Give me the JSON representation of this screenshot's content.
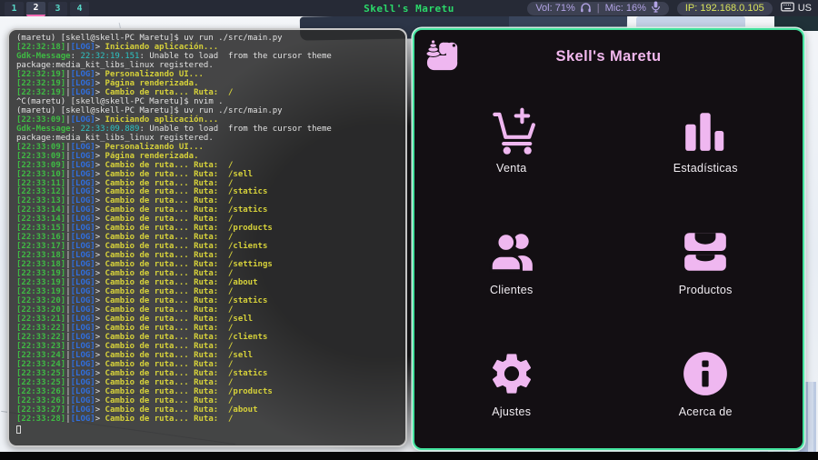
{
  "topbar": {
    "workspaces": [
      "1",
      "2",
      "3",
      "4"
    ],
    "active_workspace": "2",
    "title": "Skell's Maretu",
    "volume_label": "Vol: 71%",
    "mic_label": "Mic: 16%",
    "module_separator": "|",
    "ip_label": "IP: 192.168.0.105",
    "layout_label": "US",
    "colors": {
      "bg": "#262a36",
      "title": "#2bd96a",
      "underline": "#f56cb5",
      "module_text": "#b3a4e6",
      "ip_text": "#d9e35b",
      "ws_text": "#58d8c8"
    }
  },
  "terminal": {
    "log_tag": "LOG",
    "gdk_label": "Gdk-Message",
    "colors": {
      "white": "#e2e2e2",
      "green": "#3fba44",
      "blue": "#2f6fe0",
      "yellow": "#d6d13a",
      "cyan": "#2cc3c3"
    },
    "lines": [
      {
        "t": "cmd",
        "text": "(maretu) [skell@skell-PC Maretu]$ uv run ./src/main.py"
      },
      {
        "t": "log",
        "time": "22:32:18",
        "msg": "Iniciando aplicación..."
      },
      {
        "t": "gdk",
        "time": "22:32:19.151",
        "msg": "Unable to load  from the cursor theme"
      },
      {
        "t": "cmd",
        "text": "package:media_kit_libs_linux registered."
      },
      {
        "t": "log",
        "time": "22:32:19",
        "msg": "Personalizando UI..."
      },
      {
        "t": "log",
        "time": "22:32:19",
        "msg": "Página renderizada."
      },
      {
        "t": "log",
        "time": "22:32:19",
        "msg": "Cambio de ruta... Ruta:  /"
      },
      {
        "t": "cmd",
        "text": "^C(maretu) [skell@skell-PC Maretu]$ nvim ."
      },
      {
        "t": "cmd",
        "text": "(maretu) [skell@skell-PC Maretu]$ uv run ./src/main.py"
      },
      {
        "t": "log",
        "time": "22:33:09",
        "msg": "Iniciando aplicación..."
      },
      {
        "t": "gdk",
        "time": "22:33:09.889",
        "msg": "Unable to load  from the cursor theme"
      },
      {
        "t": "cmd",
        "text": "package:media_kit_libs_linux registered."
      },
      {
        "t": "log",
        "time": "22:33:09",
        "msg": "Personalizando UI..."
      },
      {
        "t": "log",
        "time": "22:33:09",
        "msg": "Página renderizada."
      },
      {
        "t": "log",
        "time": "22:33:09",
        "msg": "Cambio de ruta... Ruta:  /"
      },
      {
        "t": "log",
        "time": "22:33:10",
        "msg": "Cambio de ruta... Ruta:  /sell"
      },
      {
        "t": "log",
        "time": "22:33:11",
        "msg": "Cambio de ruta... Ruta:  /"
      },
      {
        "t": "log",
        "time": "22:33:12",
        "msg": "Cambio de ruta... Ruta:  /statics"
      },
      {
        "t": "log",
        "time": "22:33:13",
        "msg": "Cambio de ruta... Ruta:  /"
      },
      {
        "t": "log",
        "time": "22:33:14",
        "msg": "Cambio de ruta... Ruta:  /statics"
      },
      {
        "t": "log",
        "time": "22:33:14",
        "msg": "Cambio de ruta... Ruta:  /"
      },
      {
        "t": "log",
        "time": "22:33:15",
        "msg": "Cambio de ruta... Ruta:  /products"
      },
      {
        "t": "log",
        "time": "22:33:16",
        "msg": "Cambio de ruta... Ruta:  /"
      },
      {
        "t": "log",
        "time": "22:33:17",
        "msg": "Cambio de ruta... Ruta:  /clients"
      },
      {
        "t": "log",
        "time": "22:33:18",
        "msg": "Cambio de ruta... Ruta:  /"
      },
      {
        "t": "log",
        "time": "22:33:18",
        "msg": "Cambio de ruta... Ruta:  /settings"
      },
      {
        "t": "log",
        "time": "22:33:19",
        "msg": "Cambio de ruta... Ruta:  /"
      },
      {
        "t": "log",
        "time": "22:33:19",
        "msg": "Cambio de ruta... Ruta:  /about"
      },
      {
        "t": "log",
        "time": "22:33:19",
        "msg": "Cambio de ruta... Ruta:  /"
      },
      {
        "t": "log",
        "time": "22:33:20",
        "msg": "Cambio de ruta... Ruta:  /statics"
      },
      {
        "t": "log",
        "time": "22:33:20",
        "msg": "Cambio de ruta... Ruta:  /"
      },
      {
        "t": "log",
        "time": "22:33:21",
        "msg": "Cambio de ruta... Ruta:  /sell"
      },
      {
        "t": "log",
        "time": "22:33:22",
        "msg": "Cambio de ruta... Ruta:  /"
      },
      {
        "t": "log",
        "time": "22:33:22",
        "msg": "Cambio de ruta... Ruta:  /clients"
      },
      {
        "t": "log",
        "time": "22:33:23",
        "msg": "Cambio de ruta... Ruta:  /"
      },
      {
        "t": "log",
        "time": "22:33:24",
        "msg": "Cambio de ruta... Ruta:  /sell"
      },
      {
        "t": "log",
        "time": "22:33:24",
        "msg": "Cambio de ruta... Ruta:  /"
      },
      {
        "t": "log",
        "time": "22:33:25",
        "msg": "Cambio de ruta... Ruta:  /statics"
      },
      {
        "t": "log",
        "time": "22:33:25",
        "msg": "Cambio de ruta... Ruta:  /"
      },
      {
        "t": "log",
        "time": "22:33:26",
        "msg": "Cambio de ruta... Ruta:  /products"
      },
      {
        "t": "log",
        "time": "22:33:26",
        "msg": "Cambio de ruta... Ruta:  /"
      },
      {
        "t": "log",
        "time": "22:33:27",
        "msg": "Cambio de ruta... Ruta:  /about"
      },
      {
        "t": "log",
        "time": "22:33:28",
        "msg": "Cambio de ruta... Ruta:  /"
      }
    ]
  },
  "app": {
    "title": "Skell's Maretu",
    "menu": [
      {
        "label": "Venta",
        "icon": "cart-plus-icon"
      },
      {
        "label": "Estadísticas",
        "icon": "bar-chart-icon"
      },
      {
        "label": "Clientes",
        "icon": "people-icon"
      },
      {
        "label": "Productos",
        "icon": "inventory-icon"
      },
      {
        "label": "Ajustes",
        "icon": "gear-icon"
      },
      {
        "label": "Acerca de",
        "icon": "info-icon"
      }
    ],
    "colors": {
      "bg": "#130f13",
      "border": "#43e39e",
      "accent": "#efb7f0",
      "title": "#f2b8ee",
      "label": "#f1edf2"
    }
  }
}
